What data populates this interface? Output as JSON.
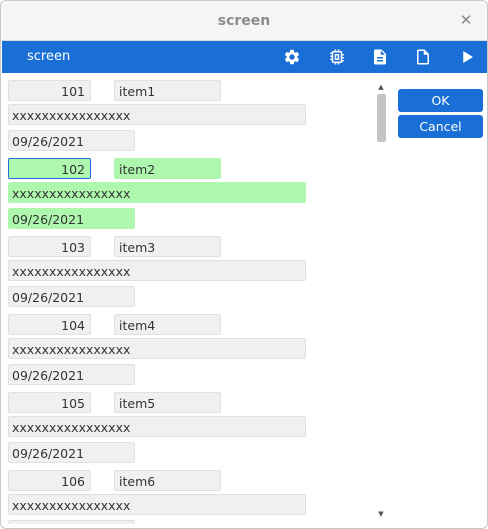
{
  "window": {
    "title": "screen"
  },
  "toolbar": {
    "title": "screen",
    "icons": [
      "gear-icon",
      "chip-icon",
      "document-lines-icon",
      "blank-document-icon",
      "play-icon"
    ]
  },
  "records": [
    {
      "number": "101",
      "name": "item1",
      "text": "xxxxxxxxxxxxxxxx",
      "date": "09/26/2021",
      "selected": false
    },
    {
      "number": "102",
      "name": "item2",
      "text": "xxxxxxxxxxxxxxxx",
      "date": "09/26/2021",
      "selected": true
    },
    {
      "number": "103",
      "name": "item3",
      "text": "xxxxxxxxxxxxxxxx",
      "date": "09/26/2021",
      "selected": false
    },
    {
      "number": "104",
      "name": "item4",
      "text": "xxxxxxxxxxxxxxxx",
      "date": "09/26/2021",
      "selected": false
    },
    {
      "number": "105",
      "name": "item5",
      "text": "xxxxxxxxxxxxxxxx",
      "date": "09/26/2021",
      "selected": false
    },
    {
      "number": "106",
      "name": "item6",
      "text": "xxxxxxxxxxxxxxxx",
      "date": "",
      "selected": false
    }
  ],
  "buttons": {
    "ok": "OK",
    "cancel": "Cancel"
  },
  "colors": {
    "accent": "#1a6fd6",
    "selected_row": "#aef7ae"
  }
}
